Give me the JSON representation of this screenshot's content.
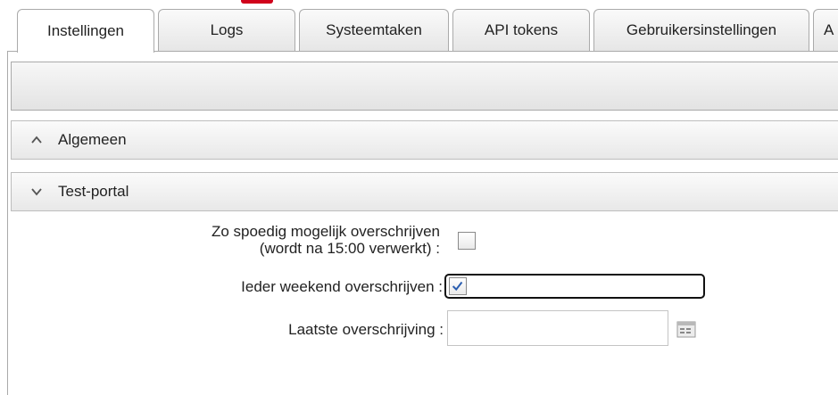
{
  "tabs": [
    {
      "label": "Instellingen",
      "active": true
    },
    {
      "label": "Logs",
      "active": false
    },
    {
      "label": "Systeemtaken",
      "active": false
    },
    {
      "label": "API tokens",
      "active": false
    },
    {
      "label": "Gebruikersinstellingen",
      "active": false
    },
    {
      "label": "A",
      "active": false
    }
  ],
  "sections": {
    "algemeen": {
      "title": "Algemeen",
      "expanded": false,
      "icon": "chevron-up-icon"
    },
    "test_portal": {
      "title": "Test-portal",
      "expanded": true,
      "icon": "chevron-down-icon"
    }
  },
  "form": {
    "asap": {
      "label_line1": "Zo spoedig mogelijk overschrijven",
      "label_line2": "(wordt na 15:00 verwerkt) :",
      "checked": false
    },
    "weekend": {
      "label": "Ieder weekend overschrijven :",
      "checked": true
    },
    "last_overwrite": {
      "label": "Laatste overschrijving :",
      "value": "",
      "icon": "calendar-icon"
    }
  },
  "colors": {
    "accent_red": "#d0021b",
    "border": "#aaaaaa",
    "check_blue": "#2a5db0"
  }
}
